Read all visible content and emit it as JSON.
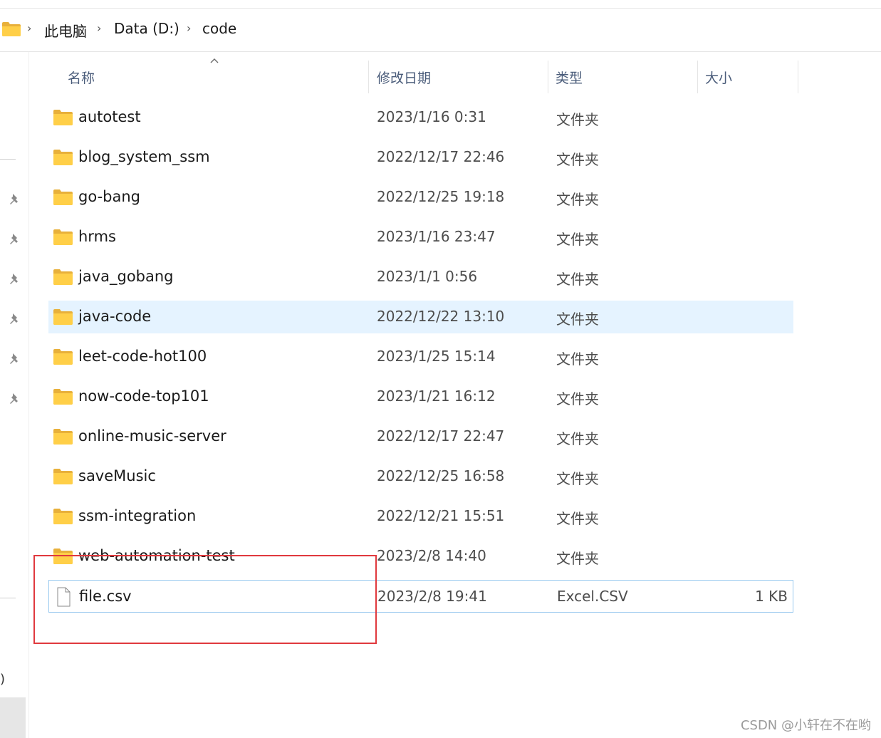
{
  "breadcrumb": {
    "items": [
      "此电脑",
      "Data (D:)",
      "code"
    ]
  },
  "columns": {
    "name": "名称",
    "modified": "修改日期",
    "type": "类型",
    "size": "大小"
  },
  "files": [
    {
      "name": "autotest",
      "modified": "2023/1/16 0:31",
      "type": "文件夹",
      "size": "",
      "kind": "folder"
    },
    {
      "name": "blog_system_ssm",
      "modified": "2022/12/17 22:46",
      "type": "文件夹",
      "size": "",
      "kind": "folder"
    },
    {
      "name": "go-bang",
      "modified": "2022/12/25 19:18",
      "type": "文件夹",
      "size": "",
      "kind": "folder"
    },
    {
      "name": "hrms",
      "modified": "2023/1/16 23:47",
      "type": "文件夹",
      "size": "",
      "kind": "folder"
    },
    {
      "name": "java_gobang",
      "modified": "2023/1/1 0:56",
      "type": "文件夹",
      "size": "",
      "kind": "folder"
    },
    {
      "name": "java-code",
      "modified": "2022/12/22 13:10",
      "type": "文件夹",
      "size": "",
      "kind": "folder"
    },
    {
      "name": "leet-code-hot100",
      "modified": "2023/1/25 15:14",
      "type": "文件夹",
      "size": "",
      "kind": "folder"
    },
    {
      "name": "now-code-top101",
      "modified": "2023/1/21 16:12",
      "type": "文件夹",
      "size": "",
      "kind": "folder"
    },
    {
      "name": "online-music-server",
      "modified": "2022/12/17 22:47",
      "type": "文件夹",
      "size": "",
      "kind": "folder"
    },
    {
      "name": "saveMusic",
      "modified": "2022/12/25 16:58",
      "type": "文件夹",
      "size": "",
      "kind": "folder"
    },
    {
      "name": "ssm-integration",
      "modified": "2022/12/21 15:51",
      "type": "文件夹",
      "size": "",
      "kind": "folder"
    },
    {
      "name": "web-automation-test",
      "modified": "2023/2/8 14:40",
      "type": "文件夹",
      "size": "",
      "kind": "folder"
    },
    {
      "name": "file.csv",
      "modified": "2023/2/8 19:41",
      "type": "Excel.CSV",
      "size": "1 KB",
      "kind": "file"
    }
  ],
  "nav": {
    "partial_text": ")"
  },
  "colors": {
    "hover_row": "#e5f3ff",
    "focus_border": "#99c9ef",
    "annotation_red": "#e0393e",
    "folder_yellow": "#ffcf48"
  },
  "icons": {
    "folder": "folder-icon",
    "file": "file-icon",
    "pin": "pin-icon",
    "chevron": "chevron-right-icon",
    "sort": "sort-up-icon"
  },
  "watermark": "CSDN @小轩在不在哟"
}
